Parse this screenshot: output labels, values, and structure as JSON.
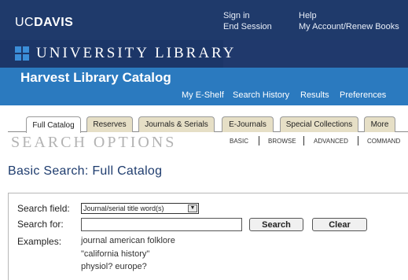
{
  "header": {
    "logo_uc": "UC",
    "logo_davis": "DAVIS",
    "links_col1": [
      "Sign in",
      "End Session"
    ],
    "links_col2": [
      "Help",
      "My Account/Renew Books"
    ],
    "library_title": "UNIVERSITY LIBRARY",
    "catalog_title": "Harvest Library Catalog",
    "catalog_links": [
      "My E-Shelf",
      "Search History",
      "Results",
      "Preferences"
    ],
    "colors": {
      "navy": "#1f3a6b",
      "catalog_blue": "#2b7abf",
      "logo_square": "#3b8ed8"
    }
  },
  "tabs": [
    {
      "label": "Full Catalog",
      "active": true
    },
    {
      "label": "Reserves",
      "active": false
    },
    {
      "label": "Journals & Serials",
      "active": false
    },
    {
      "label": "E-Journals",
      "active": false
    },
    {
      "label": "Special Collections",
      "active": false
    },
    {
      "label": "More",
      "active": false
    }
  ],
  "search_options": {
    "title": "SEARCH OPTIONS",
    "modes": [
      "BASIC",
      "BROWSE",
      "ADVANCED",
      "COMMAND"
    ]
  },
  "page_heading": "Basic Search: Full Catalog",
  "form": {
    "field_label": "Search field:",
    "field_value": "Journal/serial title word(s)",
    "for_label": "Search for:",
    "for_value": "",
    "search_button": "Search",
    "clear_button": "Clear",
    "examples_label": "Examples:",
    "examples": [
      "journal american folklore",
      "\"california history\"",
      "physiol? europe?"
    ]
  }
}
